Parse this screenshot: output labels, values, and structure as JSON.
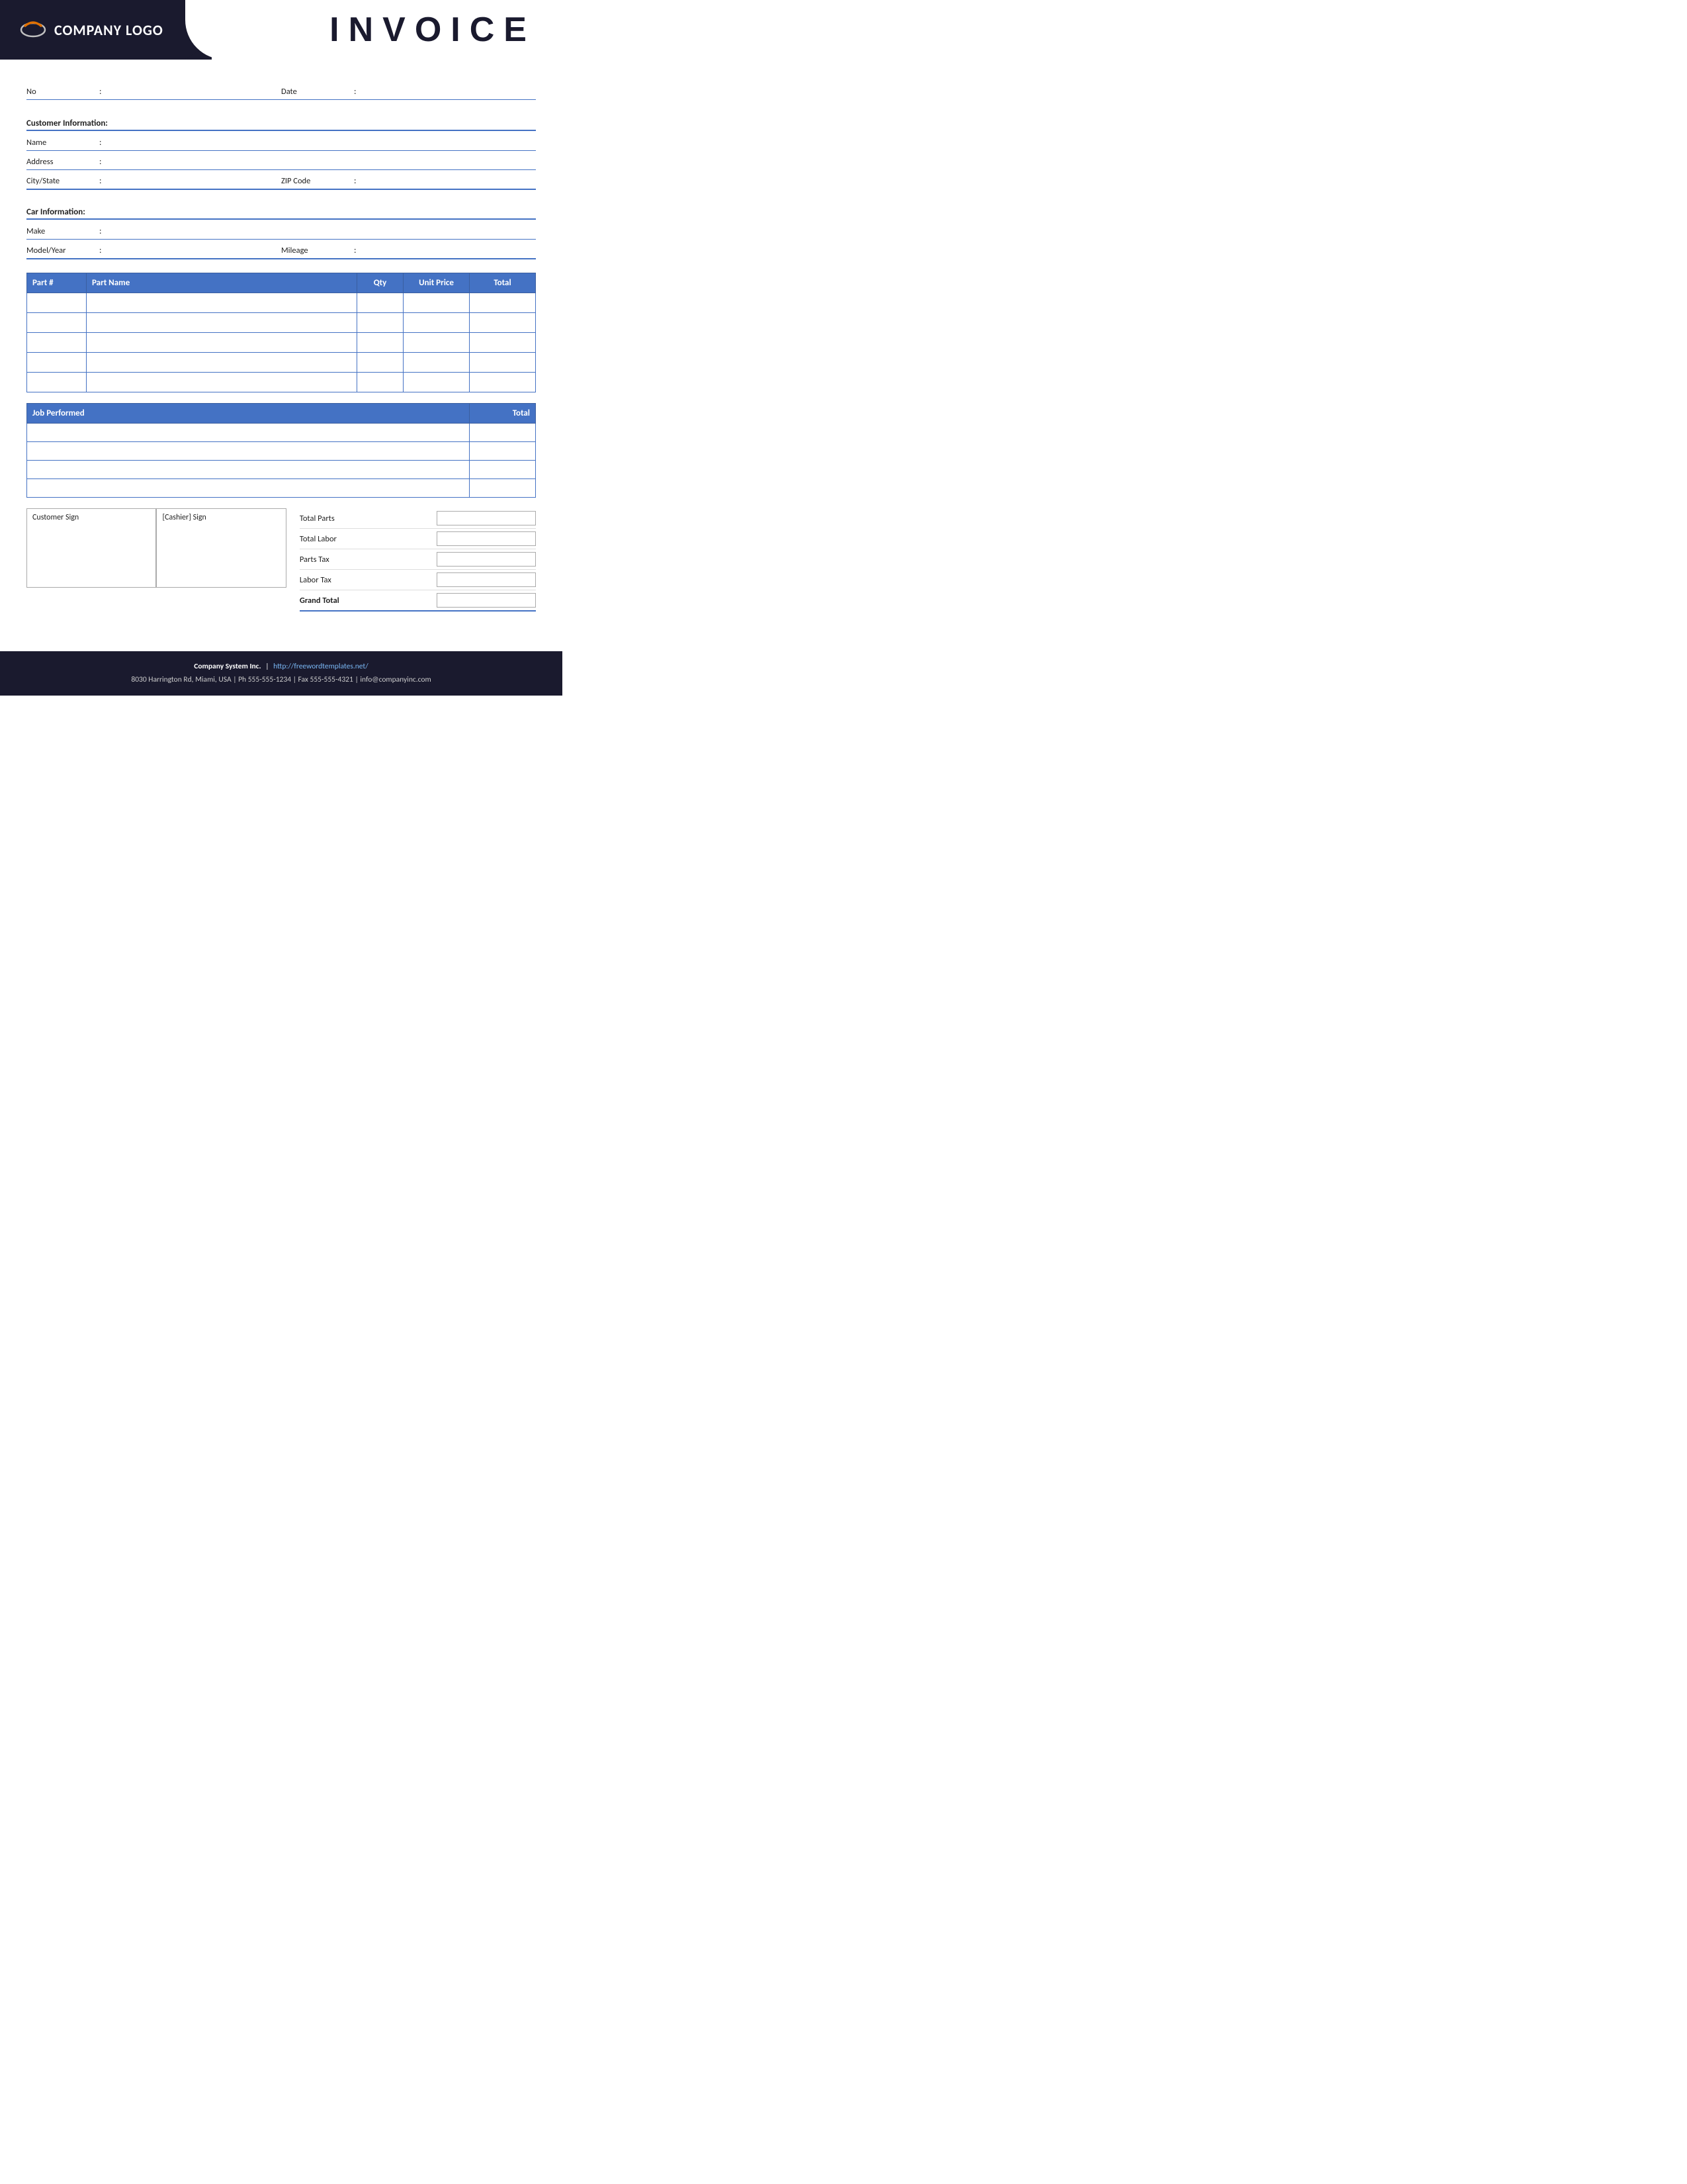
{
  "header": {
    "logo_text": "COMPANY LOGO",
    "invoice_title": "INVOICE"
  },
  "form": {
    "no_label": "No",
    "no_colon": ":",
    "date_label": "Date",
    "date_colon": ":",
    "customer_info_heading": "Customer Information:",
    "name_label": "Name",
    "address_label": "Address",
    "city_state_label": "City/State",
    "zip_code_label": "ZIP Code",
    "car_info_heading": "Car Information:",
    "make_label": "Make",
    "model_year_label": "Model/Year",
    "mileage_label": "Mileage"
  },
  "parts_table": {
    "columns": [
      "Part #",
      "Part Name",
      "Qty",
      "Unit Price",
      "Total"
    ],
    "rows": [
      {
        "part_num": "",
        "part_name": "",
        "qty": "",
        "unit_price": "",
        "total": ""
      },
      {
        "part_num": "",
        "part_name": "",
        "qty": "",
        "unit_price": "",
        "total": ""
      },
      {
        "part_num": "",
        "part_name": "",
        "qty": "",
        "unit_price": "",
        "total": ""
      },
      {
        "part_num": "",
        "part_name": "",
        "qty": "",
        "unit_price": "",
        "total": ""
      },
      {
        "part_num": "",
        "part_name": "",
        "qty": "",
        "unit_price": "",
        "total": ""
      }
    ]
  },
  "job_table": {
    "columns": [
      "Job Performed",
      "Total"
    ],
    "rows": [
      {
        "job": "",
        "total": ""
      },
      {
        "job": "",
        "total": ""
      },
      {
        "job": "",
        "total": ""
      },
      {
        "job": "",
        "total": ""
      }
    ]
  },
  "signature": {
    "customer_sign": "Customer Sign",
    "cashier_sign": "[Cashier] Sign"
  },
  "totals": {
    "total_parts_label": "Total Parts",
    "total_labor_label": "Total Labor",
    "parts_tax_label": "Parts Tax",
    "labor_tax_label": "Labor Tax",
    "grand_total_label": "Grand Total"
  },
  "footer": {
    "company_name": "Company System Inc.",
    "separator": "|",
    "website": "http://freewordtemplates.net/",
    "address": "8030 Harrington Rd, Miami, USA",
    "ph_label": "Ph",
    "ph_number": "555-555-1234",
    "fax_label": "Fax",
    "fax_number": "555-555-4321",
    "email": "info@companyinc.com"
  }
}
